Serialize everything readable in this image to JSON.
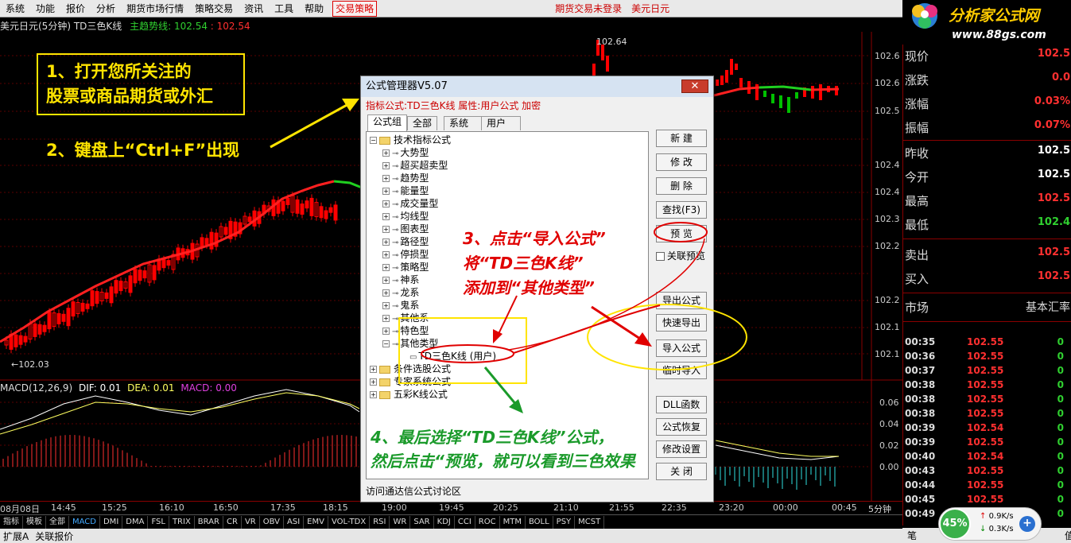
{
  "menu": {
    "items": [
      "系统",
      "功能",
      "报价",
      "分析",
      "期货市场行情",
      "策略交易",
      "资讯",
      "工具",
      "帮助"
    ],
    "active": "交易策略",
    "status1": "期货交易未登录",
    "status2": "美元日元"
  },
  "logo": {
    "name": "分析家公式网",
    "url": "www.88gs.com"
  },
  "chart": {
    "title": "美元日元(5分钟) TD三色K线",
    "indicator_label": "主趋势线:",
    "indicator_value": "102.54",
    "indicator_value2": "102.54",
    "high_label": "102.64",
    "low_label": "←102.03",
    "y_labels": [
      "102.6",
      "102.6",
      "102.5",
      "102.4",
      "102.4",
      "102.3",
      "102.2",
      "102.2",
      "102.1",
      "102.1"
    ],
    "macd_label": "MACD(12,26,9)",
    "dif": "DIF: 0.01",
    "dea": "DEA: 0.01",
    "macd": "MACD: 0.00",
    "macd_y": [
      "0.06",
      "0.04",
      "0.02",
      "0.00"
    ],
    "x_labels": [
      "08月08日",
      "14:45",
      "15:25",
      "16:10",
      "16:50",
      "17:35",
      "18:15",
      "19:00",
      "19:45",
      "20:25",
      "21:10",
      "21:55",
      "22:35",
      "23:20",
      "00:00",
      "00:45"
    ],
    "period": "5分钟",
    "colors": {
      "up": "#ff0000",
      "down": "#00c000",
      "trend": "#ff2020",
      "bg": "#000000"
    }
  },
  "indicator_tabs": [
    "指标",
    "模板",
    "全部",
    "MACD",
    "DMI",
    "DMA",
    "FSL",
    "TRIX",
    "BRAR",
    "CR",
    "VR",
    "OBV",
    "ASI",
    "EMV",
    "VOL-TDX",
    "RSI",
    "WR",
    "SAR",
    "KDJ",
    "CCI",
    "ROC",
    "MTM",
    "BOLL",
    "PSY",
    "MCST"
  ],
  "statusbar": [
    "扩展A",
    "关联报价"
  ],
  "quote": {
    "rows": [
      {
        "label": "现价",
        "value": "102.5",
        "color": "#ff3030"
      },
      {
        "label": "涨跌",
        "value": "0.0",
        "color": "#ff3030"
      },
      {
        "label": "涨幅",
        "value": "0.03%",
        "color": "#ff3030"
      },
      {
        "label": "振幅",
        "value": "0.07%",
        "color": "#ff3030"
      },
      {
        "label": "昨收",
        "value": "102.5",
        "color": "#ffffff"
      },
      {
        "label": "今开",
        "value": "102.5",
        "color": "#ffffff"
      },
      {
        "label": "最高",
        "value": "102.5",
        "color": "#ff3030"
      },
      {
        "label": "最低",
        "value": "102.4",
        "color": "#30d030"
      },
      {
        "label": "卖出",
        "value": "102.5",
        "color": "#ff3030"
      },
      {
        "label": "买入",
        "value": "102.5",
        "color": "#ff3030"
      }
    ],
    "market_label": "市场",
    "market_value": "基本汇率",
    "ticks": [
      {
        "t": "00:35",
        "p": "102.55",
        "v": "0"
      },
      {
        "t": "00:36",
        "p": "102.55",
        "v": "0"
      },
      {
        "t": "00:37",
        "p": "102.55",
        "v": "0"
      },
      {
        "t": "00:38",
        "p": "102.55",
        "v": "0"
      },
      {
        "t": "00:38",
        "p": "102.55",
        "v": "0"
      },
      {
        "t": "00:38",
        "p": "102.55",
        "v": "0"
      },
      {
        "t": "00:39",
        "p": "102.54",
        "v": "0"
      },
      {
        "t": "00:39",
        "p": "102.55",
        "v": "0"
      },
      {
        "t": "00:40",
        "p": "102.54",
        "v": "0"
      },
      {
        "t": "00:43",
        "p": "102.55",
        "v": "0"
      },
      {
        "t": "00:44",
        "p": "102.55",
        "v": "0"
      },
      {
        "t": "00:45",
        "p": "102.55",
        "v": "0"
      },
      {
        "t": "00:49",
        "p": "102.55",
        "v": "0"
      }
    ],
    "bottom_tabs": [
      "笔",
      "价",
      "值"
    ]
  },
  "network": {
    "percent": "45%",
    "up": "0.9K/s",
    "down": "0.3K/s"
  },
  "dialog": {
    "title": "公式管理器V5.07",
    "close": "✕",
    "info": "指标公式:TD三色K线  属性:用户公式  加密",
    "tabs": [
      "公式组",
      "全部",
      "系统",
      "用户"
    ],
    "tree_root": "技术指标公式",
    "tree_items": [
      "大势型",
      "超买超卖型",
      "趋势型",
      "能量型",
      "成交量型",
      "均线型",
      "图表型",
      "路径型",
      "停损型",
      "策略型",
      "神系",
      "龙系",
      "鬼系",
      "其他系",
      "特色型",
      "其他类型"
    ],
    "selected_formula": "TD三色K线   (用户)",
    "other_groups": [
      "条件选股公式",
      "专家系统公式",
      "五彩K线公式"
    ],
    "buttons": [
      "新 建",
      "修 改",
      "删 除",
      "查找(F3)",
      "预 览"
    ],
    "checkbox": "关联预览",
    "buttons2": [
      "导出公式",
      "快速导出",
      "导入公式",
      "临时导入"
    ],
    "buttons3": [
      "DLL函数",
      "公式恢复",
      "修改设置",
      "关 闭"
    ],
    "footer": "访问通达信公式讨论区"
  },
  "annotations": {
    "step1a": "1、打开您所关注的",
    "step1b": "股票或商品期货或外汇",
    "step2": "2、键盘上“Ctrl+F”出现",
    "step3a": "3、点击“导入公式”",
    "step3b": "将“TD三色K线”",
    "step3c": "添加到“其他类型”",
    "step4a": "4、最后选择“TD三色K线”公式，",
    "step4b": "然后点击“预览，就可以看到三色效果"
  }
}
